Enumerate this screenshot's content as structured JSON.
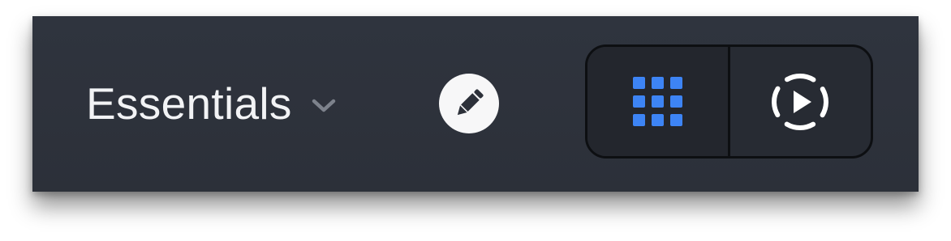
{
  "toolbar": {
    "workspace_title": "Essentials",
    "workspace_dropdown_icon": "chevron-down-icon",
    "edit_icon": "pencil-icon",
    "view_modes": [
      {
        "id": "grid",
        "icon": "grid-icon",
        "selected": true,
        "color": "#3d84f5"
      },
      {
        "id": "play",
        "icon": "play-circle-icon",
        "selected": false,
        "color": "#ffffff"
      }
    ]
  },
  "colors": {
    "background": "#2f343e",
    "accent": "#3d84f5",
    "text": "#f2f3f5"
  }
}
